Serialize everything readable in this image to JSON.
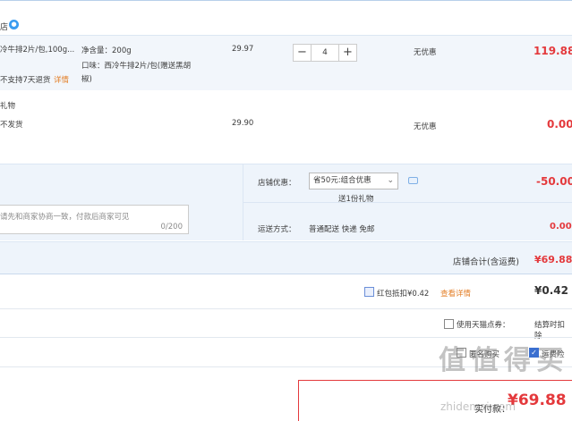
{
  "store": {
    "name": "店",
    "chat_icon": "wangwang-chat-icon"
  },
  "items": [
    {
      "title": "冷牛排2片/包,100g...",
      "title2": "不支持7天退货",
      "detail_link": "详情",
      "spec_line1": "净含量：200g",
      "spec_line2": "口味：西冷牛排2片/包(赠送黑胡",
      "spec_line3": "椒)",
      "price": "29.97",
      "qty_minus": "−",
      "qty": "4",
      "qty_plus": "+",
      "discount": "无优惠",
      "subtotal": "119.88"
    },
    {
      "section_label": "礼物",
      "title": "不发货",
      "price": "29.90",
      "discount": "无优惠",
      "subtotal": "0.00"
    }
  ],
  "message": {
    "placeholder": "请先和商家协商一致，付款后商家可见",
    "counter": "0/200"
  },
  "promo": {
    "label": "店铺优惠：",
    "selected": "省50元:组合优惠",
    "chevron": "chevron-down-icon",
    "gift_note": "送1份礼物",
    "amount": "-50.00"
  },
  "shipping": {
    "label": "运送方式：",
    "value": "普通配送 快递 免邮",
    "amount": "0.00"
  },
  "store_total": {
    "label": "店铺合计(含运费)",
    "amount": "¥69.88"
  },
  "redpacket": {
    "label": "红包抵扣¥0.42",
    "link": "查看详情",
    "amount": "¥0.42"
  },
  "points": {
    "label": "使用天猫点券：",
    "note": "结算时扣除"
  },
  "options": {
    "anonymous": "匿名购买",
    "insurance": "运费险"
  },
  "pay": {
    "label": "实付款：",
    "amount": "¥69.88"
  },
  "watermark": {
    "glyphs": "值 值 得 买",
    "url": "zhidemai.com"
  }
}
